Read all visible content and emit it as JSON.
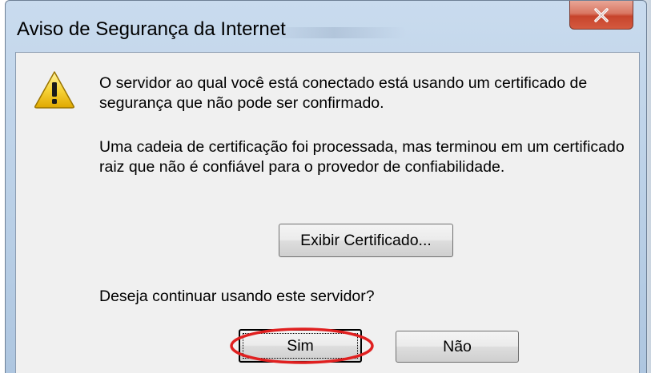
{
  "window": {
    "title": "Aviso de Segurança da Internet",
    "close_icon": "close-icon"
  },
  "dialog": {
    "icon": "warning-icon",
    "message_1": "O servidor ao qual você está conectado está usando um certificado de segurança que não pode ser confirmado.",
    "message_2": "Uma cadeia de certificação foi processada, mas terminou em um certificado raiz que não é confiável para o provedor de confiabilidade.",
    "view_certificate_label": "Exibir Certificado...",
    "question": "Deseja continuar usando este servidor?",
    "yes_label": "Sim",
    "no_label": "Não"
  },
  "colors": {
    "annotation": "#e02020",
    "close_button": "#c7442c"
  }
}
